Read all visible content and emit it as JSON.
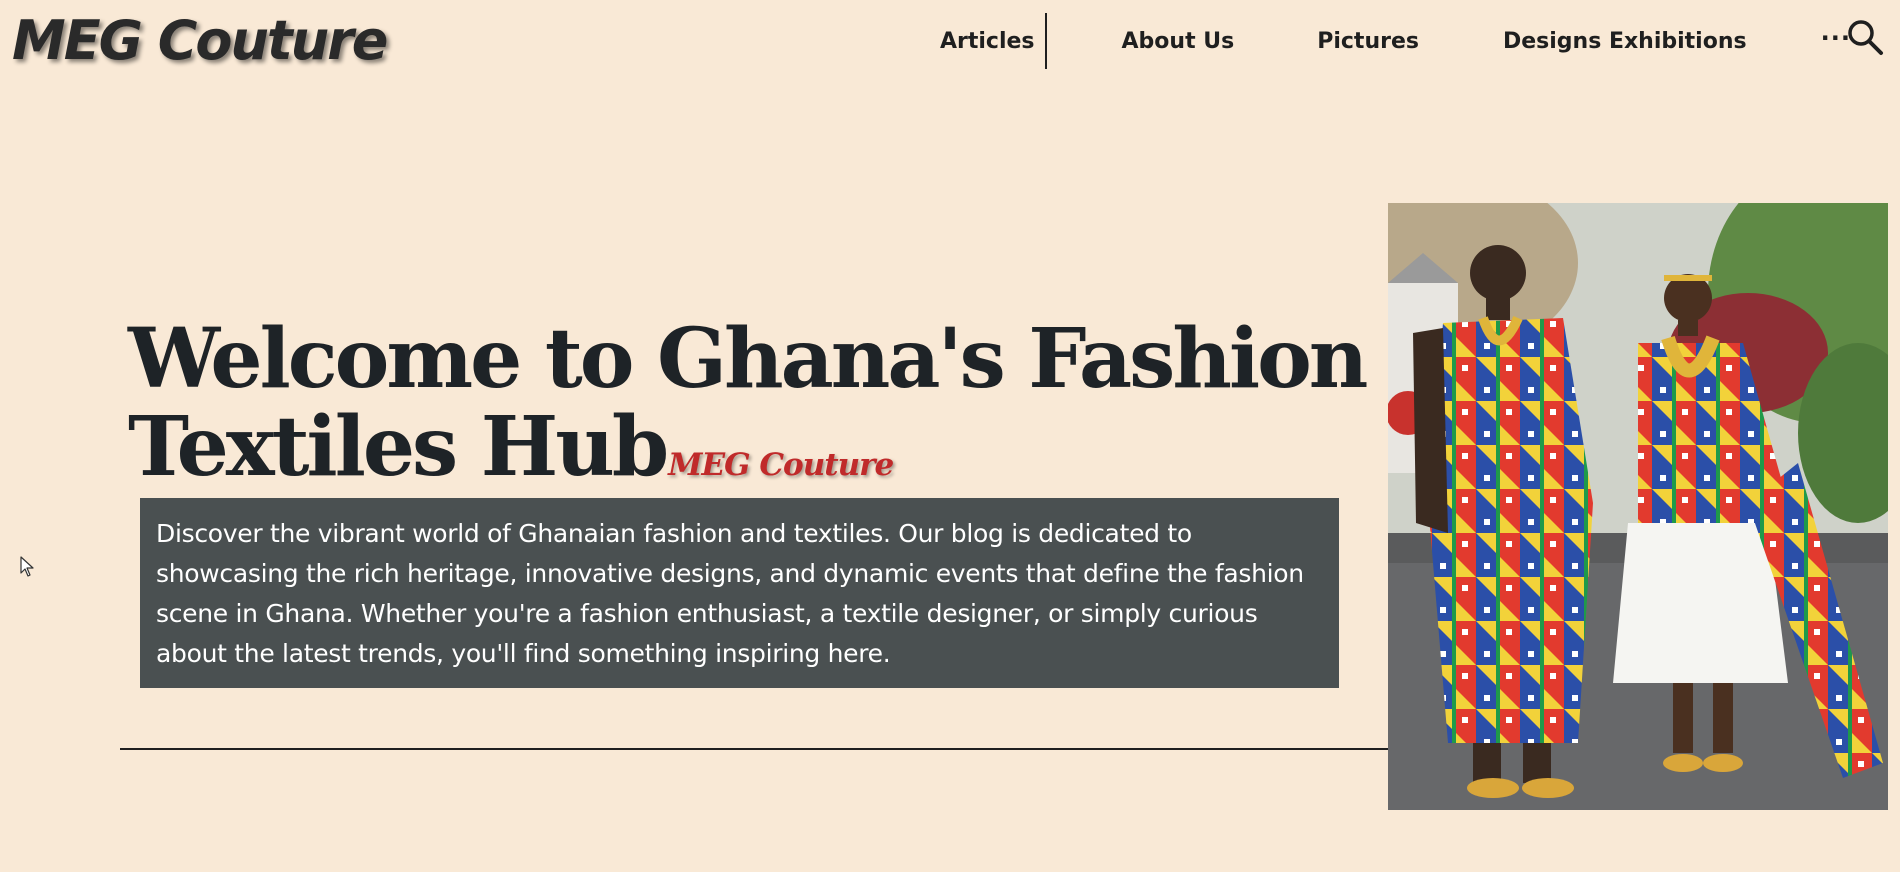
{
  "site": {
    "logo": "MEG Couture"
  },
  "nav": {
    "items": [
      {
        "label": "Articles"
      },
      {
        "label": "About Us"
      },
      {
        "label": "Pictures"
      },
      {
        "label": "Designs Exhibitions"
      },
      {
        "label": "···"
      }
    ],
    "search_icon": "search-icon"
  },
  "hero": {
    "title_line1": "Welcome to Ghana's Fashion &",
    "title_line2": "Textiles Hub",
    "brand_tag": "MEG Couture",
    "intro": "Discover the vibrant world of Ghanaian fashion and textiles. Our blog is dedicated to showcasing the rich heritage, innovative designs, and dynamic events that define the fashion scene in Ghana. Whether you're a fashion enthusiast, a textile designer, or simply curious about the latest trends, you'll find something inspiring here.",
    "image": "couple-in-kente-cloth-photo"
  },
  "colors": {
    "page_background": "#f9e9d6",
    "intro_box": "#4a5051",
    "heading_text": "#1e2327",
    "brand_accent": "#c02a2a"
  }
}
